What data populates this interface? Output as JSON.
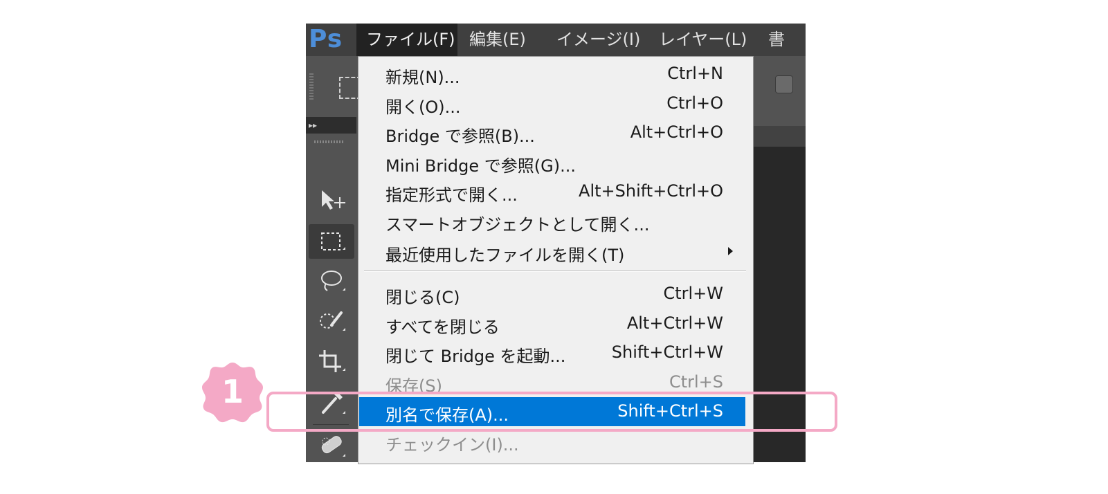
{
  "app": {
    "logo_text": "Ps"
  },
  "menubar": {
    "items": [
      {
        "label": "ファイル(F)"
      },
      {
        "label": "編集(E)"
      },
      {
        "label": "イメージ(I)"
      },
      {
        "label": "レイヤー(L)"
      },
      {
        "label": "書"
      }
    ]
  },
  "toolbox": {
    "header_glyph": "▸▸"
  },
  "file_menu": {
    "items": [
      {
        "label": "新規(N)...",
        "shortcut": "Ctrl+N"
      },
      {
        "label": "開く(O)...",
        "shortcut": "Ctrl+O"
      },
      {
        "label": "Bridge で参照(B)...",
        "shortcut": "Alt+Ctrl+O"
      },
      {
        "label": "Mini Bridge で参照(G)...",
        "shortcut": ""
      },
      {
        "label": "指定形式で開く...",
        "shortcut": "Alt+Shift+Ctrl+O"
      },
      {
        "label": "スマートオブジェクトとして開く...",
        "shortcut": ""
      },
      {
        "label": "最近使用したファイルを開く(T)",
        "shortcut": ""
      },
      {
        "label": "閉じる(C)",
        "shortcut": "Ctrl+W"
      },
      {
        "label": "すべてを閉じる",
        "shortcut": "Alt+Ctrl+W"
      },
      {
        "label": "閉じて Bridge を起動...",
        "shortcut": "Shift+Ctrl+W"
      },
      {
        "label": "保存(S)",
        "shortcut": "Ctrl+S"
      },
      {
        "label": "別名で保存(A)...",
        "shortcut": "Shift+Ctrl+S"
      },
      {
        "label": "チェックイン(I)...",
        "shortcut": ""
      }
    ]
  },
  "callout": {
    "step_number": "1"
  },
  "colors": {
    "highlight": "#0078d7",
    "callout_pink": "#f4a9c6",
    "menubar_bg": "#3f3f3f",
    "logo_blue": "#4d8ed9"
  }
}
